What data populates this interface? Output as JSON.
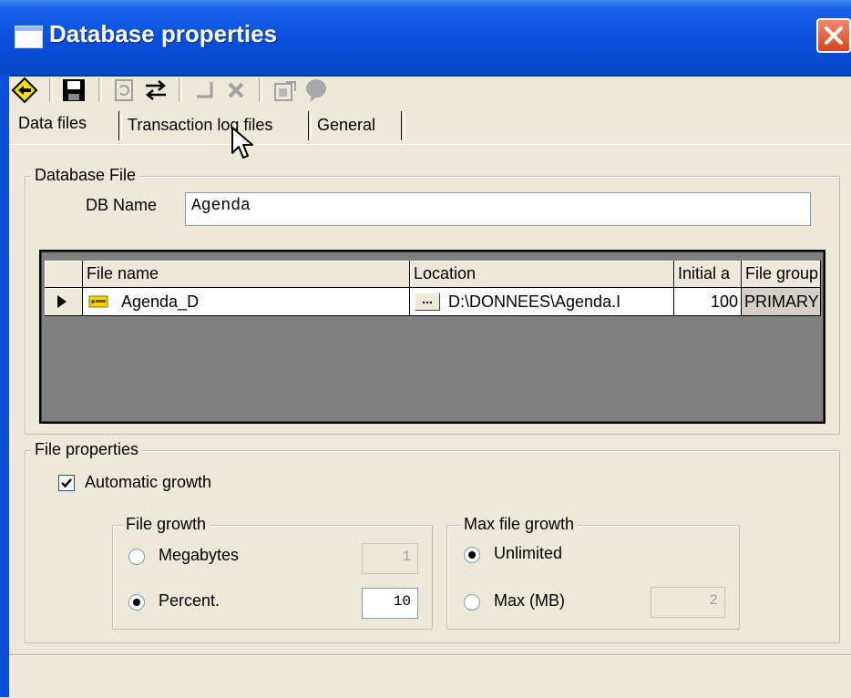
{
  "window": {
    "title": "Database properties"
  },
  "toolbar": {
    "icons": [
      "back-arrow-icon",
      "save-icon",
      "refresh-icon",
      "swap-icon",
      "undo-icon",
      "delete-icon",
      "properties-icon",
      "help-icon"
    ]
  },
  "tabs": [
    {
      "label": "Data files",
      "active": true
    },
    {
      "label": "Transaction log files",
      "active": false
    },
    {
      "label": "General",
      "active": false
    }
  ],
  "database_file": {
    "group_title": "Database File",
    "db_name_label": "DB Name",
    "db_name_value": "Agenda"
  },
  "files_grid": {
    "columns": [
      "File name",
      "Location",
      "Initial a",
      "File group"
    ],
    "rows": [
      {
        "file_name": "Agenda_D",
        "browse": "...",
        "location": "D:\\DONNEES\\Agenda.I",
        "initial": "100",
        "file_group": "PRIMARY"
      }
    ]
  },
  "file_properties": {
    "group_title": "File properties",
    "automatic_growth_label": "Automatic growth",
    "automatic_growth_checked": true,
    "file_growth": {
      "title": "File growth",
      "megabytes_label": "Megabytes",
      "megabytes_value": "1",
      "percent_label": "Percent.",
      "percent_value": "10",
      "selected": "percent"
    },
    "max_file_growth": {
      "title": "Max file growth",
      "unlimited_label": "Unlimited",
      "max_label": "Max (MB)",
      "max_value": "2",
      "selected": "unlimited"
    }
  },
  "colors": {
    "titlebar": "#0a4fdc",
    "window_bg": "#ece9d8",
    "grid_bg": "#808080",
    "close_button": "#d9431d"
  }
}
